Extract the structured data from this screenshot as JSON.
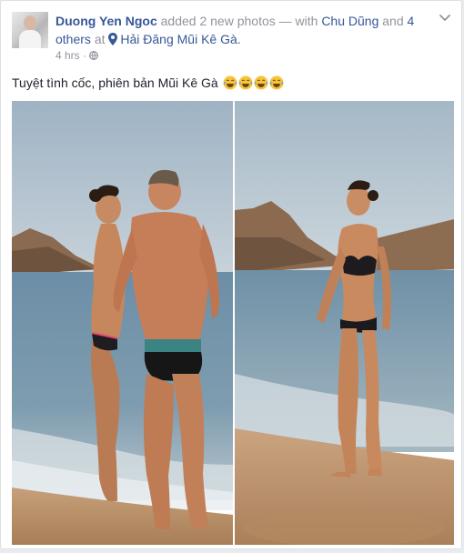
{
  "post": {
    "author": "Duong Yen Ngoc",
    "action_text": "added 2 new photos — with",
    "tagged_person": "Chu Dũng",
    "and_word": "and",
    "others_text": "4 others",
    "at_word": "at",
    "location": "Hải Đăng Mũi Kê Gà.",
    "time": "4 hrs",
    "separator": "·",
    "caption": "Tuyệt tình cốc, phiên bản Mũi Kê Gà",
    "emoji": [
      "😂",
      "😂",
      "😂",
      "😂"
    ],
    "privacy_icon": "globe-icon",
    "menu_icon": "chevron-down-icon"
  },
  "photos": [
    {
      "subject": "couple-on-beach"
    },
    {
      "subject": "woman-on-beach"
    }
  ],
  "colors": {
    "link": "#365899",
    "muted": "#90949c",
    "text": "#1d2129",
    "border": "#dddfe2"
  }
}
